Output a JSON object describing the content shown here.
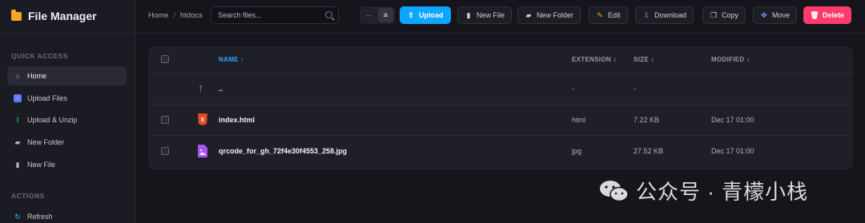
{
  "app": {
    "title": "File Manager"
  },
  "sidebar": {
    "quick_access_title": "QUICK ACCESS",
    "items": [
      {
        "label": "Home",
        "icon": "home-icon",
        "active": true
      },
      {
        "label": "Upload Files",
        "icon": "upload-icon"
      },
      {
        "label": "Upload & Unzip",
        "icon": "upload-unzip-icon"
      },
      {
        "label": "New Folder",
        "icon": "folder-plus-icon"
      },
      {
        "label": "New File",
        "icon": "file-plus-icon"
      }
    ],
    "actions_title": "ACTIONS",
    "actions": [
      {
        "label": "Refresh",
        "icon": "refresh-icon"
      }
    ]
  },
  "header": {
    "breadcrumb": [
      "Home",
      "htdocs"
    ],
    "breadcrumb_sep": "/",
    "search": {
      "placeholder": "Search files..."
    },
    "view_toggle": {
      "list": "··",
      "grid": "≡"
    },
    "buttons": {
      "upload": "Upload",
      "new_file": "New File",
      "new_folder": "New Folder",
      "edit": "Edit",
      "download": "Download",
      "copy": "Copy",
      "move": "Move",
      "delete": "Delete"
    }
  },
  "table": {
    "headers": {
      "name": "NAME ↑",
      "extension": "EXTENSION ↕",
      "size": "SIZE ↕",
      "modified": "MODIFIED ↕"
    },
    "rows": [
      {
        "name": "..",
        "extension": "-",
        "size": "-",
        "modified": "",
        "icon": "up-arrow-icon"
      },
      {
        "name": "index.html",
        "extension": "html",
        "size": "7.22 KB",
        "modified": "Dec 17 01:00",
        "icon": "html5-icon"
      },
      {
        "name": "qrcode_for_gh_72f4e30f4553_258.jpg",
        "extension": "jpg",
        "size": "27.52 KB",
        "modified": "Dec 17 01:00",
        "icon": "image-file-icon"
      }
    ]
  },
  "watermark": {
    "text": "公众号 · 青檬小栈"
  },
  "colors": {
    "accent": "#0ea5ff",
    "danger": "#ff3b6b",
    "folder": "#f5a623",
    "html": "#e44d26",
    "image": "#a855f7"
  }
}
